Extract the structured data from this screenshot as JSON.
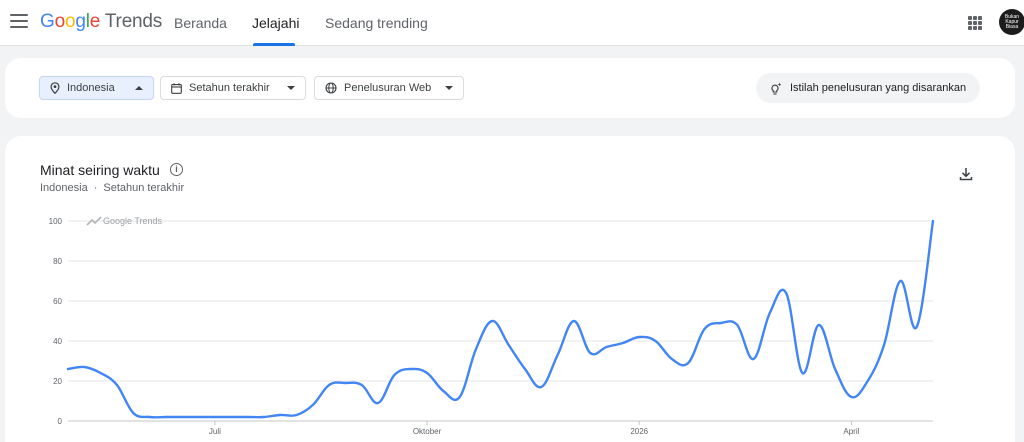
{
  "header": {
    "logo": {
      "part1": "G",
      "part2": "o",
      "part3": "o",
      "part4": "g",
      "part5": "l",
      "part6": "e",
      "part7": " Trends"
    },
    "tabs": [
      {
        "label": "Beranda",
        "active": false
      },
      {
        "label": "Jelajahi",
        "active": true
      },
      {
        "label": "Sedang trending",
        "active": false
      }
    ],
    "avatar_text": "Bukan Kapur Biasa"
  },
  "filters": {
    "location": "Indonesia",
    "time_range": "Setahun terakhir",
    "search_type": "Penelusuran Web",
    "suggested": "Istilah penelusuran yang disarankan"
  },
  "card": {
    "title": "Minat seiring waktu",
    "subtitle_location": "Indonesia",
    "subtitle_separator": "·",
    "subtitle_time": "Setahun terakhir",
    "watermark": "Google Trends"
  },
  "chart_data": {
    "type": "line",
    "ylim": [
      0,
      100
    ],
    "yticks": [
      "0",
      "20",
      "40",
      "60",
      "80",
      "100"
    ],
    "xlabels": [
      "Juli",
      "Oktober",
      "2026",
      "April"
    ],
    "xlabel_index": [
      9,
      22,
      35,
      48
    ],
    "grid": true,
    "color": "#4285f4",
    "values": [
      26,
      27,
      24,
      18,
      4,
      2,
      2,
      2,
      2,
      2,
      2,
      2,
      2,
      3,
      3,
      8,
      18,
      19,
      18,
      9,
      23,
      26,
      24,
      15,
      12,
      36,
      50,
      38,
      26,
      17,
      33,
      50,
      34,
      37,
      39,
      42,
      40,
      31,
      29,
      46,
      49,
      48,
      31,
      54,
      64,
      24,
      48,
      26,
      12,
      20,
      38,
      70,
      47,
      100
    ]
  }
}
